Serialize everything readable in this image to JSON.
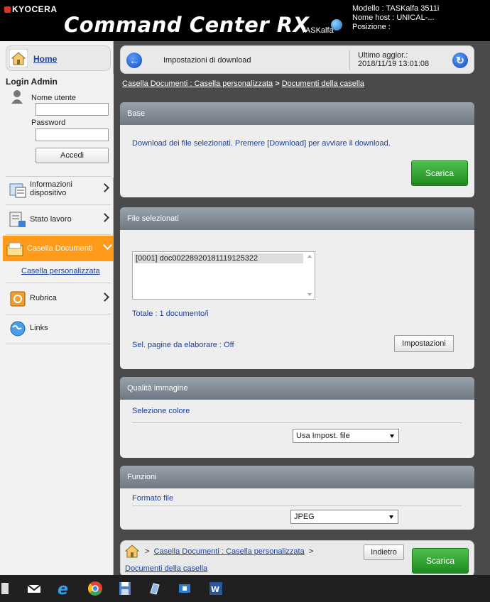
{
  "header": {
    "brand": "KYOCERA",
    "app_title": "Command Center RX",
    "product_badge": "TASKalfa",
    "device_model": "Modello : TASKalfa 3511i",
    "host_name": "Nome host : UNICAL-...",
    "position": "Posizione :"
  },
  "sidebar": {
    "home_label": "Home",
    "login_title": "Login Admin",
    "username_label": "Nome utente",
    "username_value": "",
    "password_label": "Password",
    "password_value": "",
    "login_button": "Accedi",
    "items": [
      {
        "label": "Informazioni dispositivo"
      },
      {
        "label": "Stato lavoro"
      },
      {
        "label": "Casella Documenti"
      },
      {
        "label": "Rubrica"
      },
      {
        "label": "Links"
      }
    ],
    "sub_item": "Casella personalizzata"
  },
  "topbar": {
    "title": "Impostazioni di download",
    "last_update_label": "Ultimo aggior.:",
    "last_update_value": "2018/11/19 13:01:08"
  },
  "breadcrumb": {
    "part1": "Casella Documenti : Casella personalizzata",
    "sep": ">",
    "part2": "Documenti della casella"
  },
  "base": {
    "heading": "Base",
    "text": "Download dei file selezionati. Premere [Download] per avviare il download.",
    "download_button": "Scarica"
  },
  "files": {
    "heading": "File selezionati",
    "items": [
      "[0001] doc00228920181119125322"
    ],
    "total": "Totale  :   1 documento/i",
    "page_sel": "Sel. pagine da elaborare :   Off",
    "settings_button": "Impostazioni"
  },
  "quality": {
    "heading": "Qualità immagine",
    "color_label": "Selezione colore",
    "color_value": "Usa Impost. file"
  },
  "functions": {
    "heading": "Funzioni",
    "format_label": "Formato file",
    "format_value": "JPEG"
  },
  "footer": {
    "crumb_sep": ">",
    "crumb1": "Casella Documenti : Casella personalizzata",
    "crumb2": "Documenti della casella",
    "back_button": "Indietro",
    "download_button": "Scarica"
  }
}
